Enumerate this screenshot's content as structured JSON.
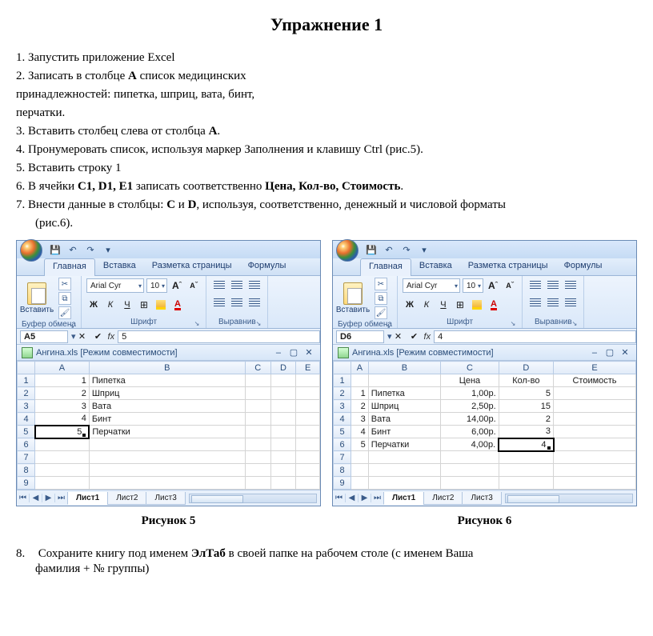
{
  "title": "Упражнение 1",
  "instructions": {
    "i1": "1.   Запустить приложение Excel",
    "i2a": "2.   Записать в столбце ",
    "i2b": "A",
    "i2c": " список медицинских",
    "i2d": "принадлежностей: пипетка, шприц, вата, бинт,",
    "i2e": "перчатки.",
    "i3a": "3.   Вставить столбец слева от столбца ",
    "i3b": "A",
    "i3c": ".",
    "i4": "4.   Пронумеровать список, используя маркер Заполнения  и клавишу Ctrl (рис.5).",
    "i5": "5.   Вставить строку 1",
    "i6a": "6.   В ячейки ",
    "i6b": "C1, D1, E1",
    "i6c": " записать соответственно ",
    "i6d": "Цена,  Кол-во, Стоимость",
    "i6e": ".",
    "i7a": "7.   Внести данные в столбцы: ",
    "i7b": "C",
    "i7c": " и ",
    "i7d": "D",
    "i7e": ", используя, соответственно, денежный и числовой форматы",
    "i7f": "(рис.6)."
  },
  "ribbon": {
    "tabs": [
      "Главная",
      "Вставка",
      "Разметка страницы",
      "Формулы"
    ],
    "paste": "Вставить",
    "clipboard": "Буфер обмена",
    "font": "Шрифт",
    "align": "Выравнив",
    "fontname": "Arial Cyr",
    "fontsize": "10",
    "bold": "Ж",
    "italic": "К",
    "underline": "Ч",
    "Aa": "A",
    "fx": "fx"
  },
  "fig5": {
    "namebox": "A5",
    "fx_value": "5",
    "doc_title": "Ангина.xls  [Режим совместимости]",
    "cols": [
      "A",
      "B",
      "C",
      "D",
      "E"
    ],
    "rows": [
      "1",
      "2",
      "3",
      "4",
      "5",
      "6",
      "7",
      "8",
      "9"
    ],
    "data": {
      "r1": {
        "A": "1",
        "B": "Пипетка"
      },
      "r2": {
        "A": "2",
        "B": "Шприц"
      },
      "r3": {
        "A": "3",
        "B": "Вата"
      },
      "r4": {
        "A": "4",
        "B": "Бинт"
      },
      "r5": {
        "A": "5",
        "B": "Перчатки"
      }
    },
    "sheets": [
      "Лист1",
      "Лист2",
      "Лист3"
    ],
    "caption": "Рисунок 5"
  },
  "fig6": {
    "namebox": "D6",
    "fx_value": "4",
    "doc_title": "Ангина.xls  [Режим совместимости]",
    "cols": [
      "A",
      "B",
      "C",
      "D",
      "E"
    ],
    "rows": [
      "1",
      "2",
      "3",
      "4",
      "5",
      "6",
      "7",
      "8",
      "9"
    ],
    "headers": {
      "C": "Цена",
      "D": "Кол-во",
      "E": "Стоимость"
    },
    "data": {
      "r2": {
        "A": "1",
        "B": "Пипетка",
        "C": "1,00р.",
        "D": "5"
      },
      "r3": {
        "A": "2",
        "B": "Шприц",
        "C": "2,50р.",
        "D": "15"
      },
      "r4": {
        "A": "3",
        "B": "Вата",
        "C": "14,00р.",
        "D": "2"
      },
      "r5": {
        "A": "4",
        "B": "Бинт",
        "C": "6,00р.",
        "D": "3"
      },
      "r6": {
        "A": "5",
        "B": "Перчатки",
        "C": "4,00р.",
        "D": "4"
      }
    },
    "sheets": [
      "Лист1",
      "Лист2",
      "Лист3"
    ],
    "caption": "Рисунок 6"
  },
  "final": {
    "n": "8.",
    "a": "Сохраните книгу под именем ",
    "b": "ЭлТаб",
    "c": " в своей папке на рабочем столе (с именем    Ваша",
    "d": "фамилия + № группы)"
  }
}
